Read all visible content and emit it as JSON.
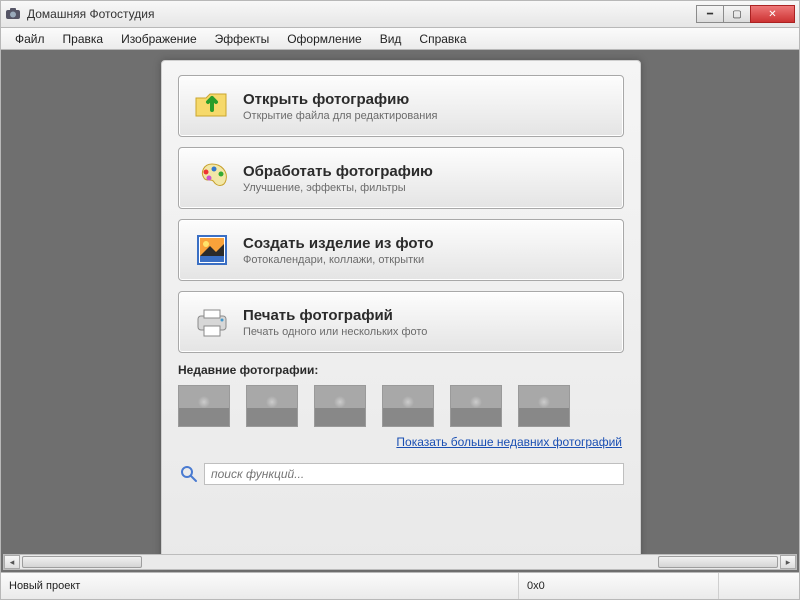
{
  "window": {
    "title": "Домашняя Фотостудия"
  },
  "menu": {
    "items": [
      "Файл",
      "Правка",
      "Изображение",
      "Эффекты",
      "Оформление",
      "Вид",
      "Справка"
    ]
  },
  "welcome": {
    "actions": [
      {
        "title": "Открыть фотографию",
        "subtitle": "Открытие файла для редактирования",
        "icon": "folder-open"
      },
      {
        "title": "Обработать фотографию",
        "subtitle": "Улучшение, эффекты, фильтры",
        "icon": "palette"
      },
      {
        "title": "Создать изделие из фото",
        "subtitle": "Фотокалендари, коллажи, открытки",
        "icon": "landscape"
      },
      {
        "title": "Печать фотографий",
        "subtitle": "Печать одного или нескольких фото",
        "icon": "printer"
      }
    ],
    "recent_label": "Недавние фотографии:",
    "show_more": "Показать больше недавних фотографий",
    "search_placeholder": "поиск функций..."
  },
  "status": {
    "project": "Новый проект",
    "dimensions": "0x0"
  }
}
